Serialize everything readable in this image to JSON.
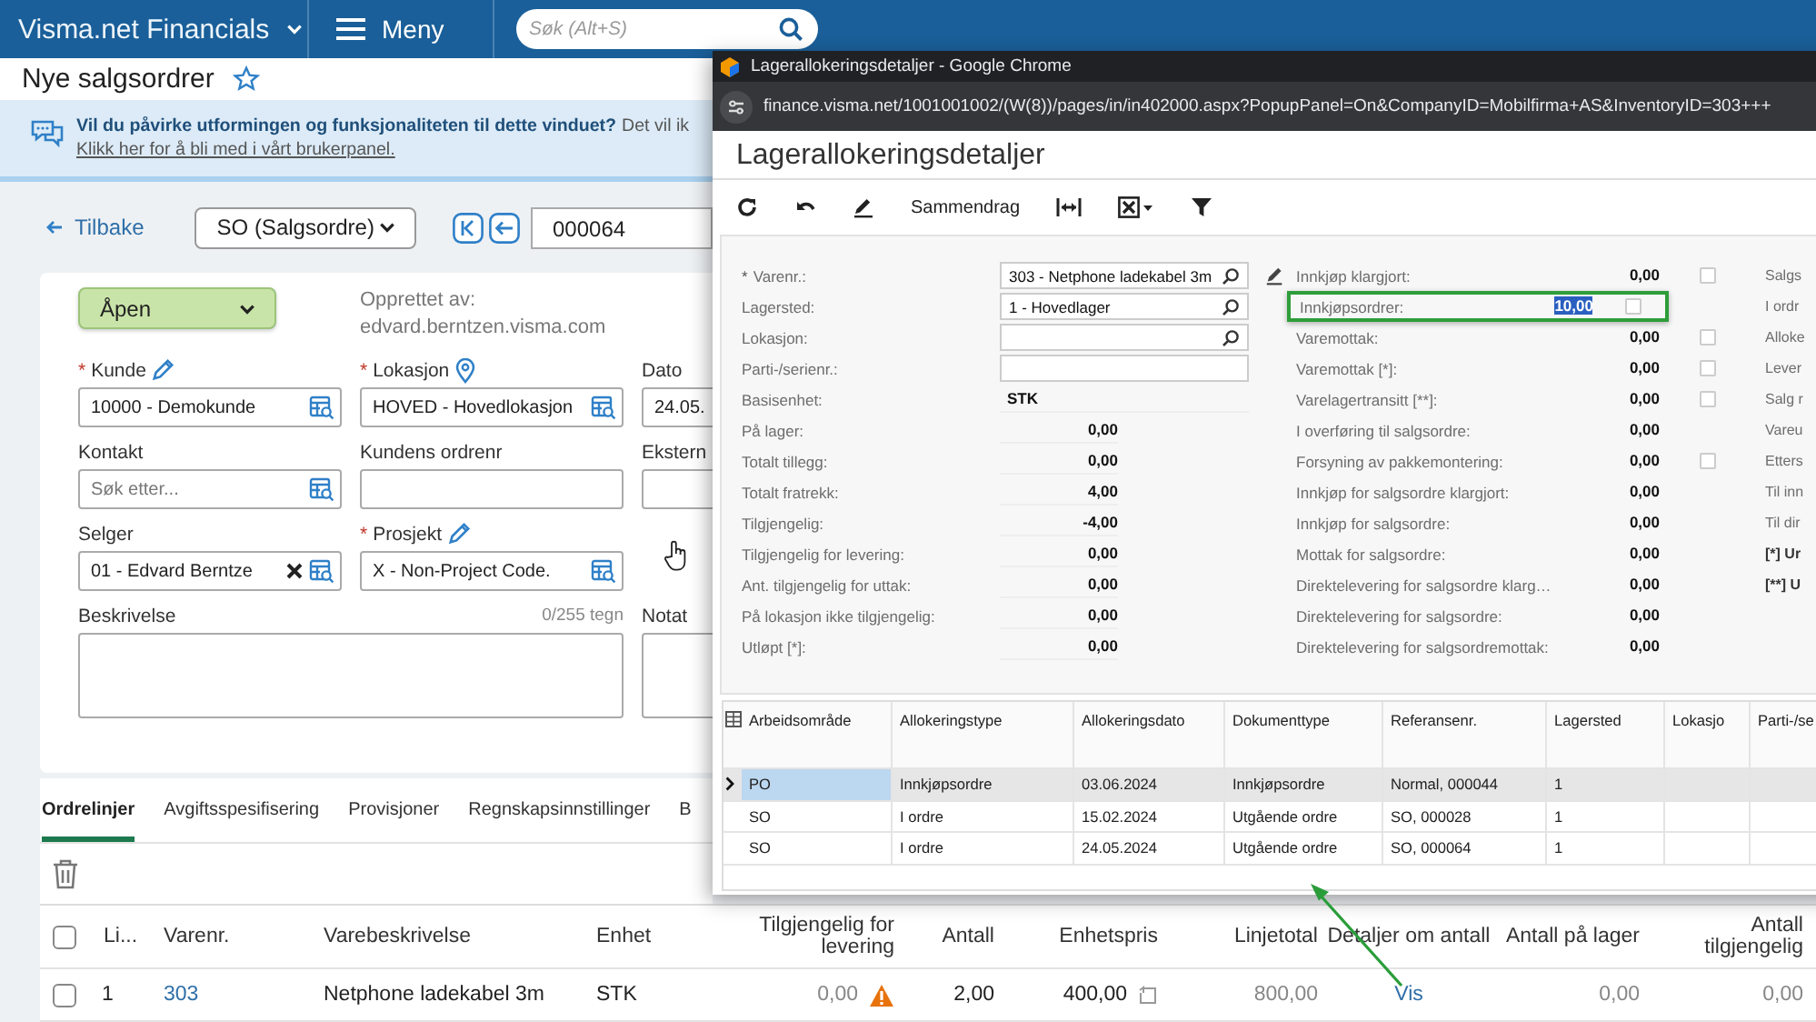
{
  "header": {
    "app_title": "Visma.net Financials",
    "menu_label": "Meny",
    "search": {
      "placeholder": "Søk (Alt+S)"
    }
  },
  "page": {
    "title": "Nye salgsordrer"
  },
  "banner": {
    "question": "Vil du påvirke utformingen og funksjonaliteten til dette vinduet?",
    "continuation": "Det vil ik",
    "link": "Klikk her for å bli med i vårt brukerpanel."
  },
  "nav": {
    "back": "Tilbake",
    "order_type": "SO (Salgsordre)",
    "order_number": "000064"
  },
  "form": {
    "status": "Åpen",
    "created_by_label": "Opprettet av:",
    "created_by": "edvard.berntzen.visma.com",
    "fields": [
      {
        "label": "Kunde",
        "required_mark": "*",
        "edit_link": true,
        "kind": "lookup",
        "value": "10000 - Demokunde"
      },
      {
        "label": "Lokasjon",
        "required_mark": "*",
        "location_link": true,
        "kind": "lookup",
        "value": "HOVED - Hovedlokasjon"
      },
      {
        "label": "Dato",
        "kind": "text",
        "value": "24.05."
      },
      {
        "label": "Kontakt",
        "kind": "lookup",
        "placeholder": "Søk etter..."
      },
      {
        "label": "Kundens ordrenr",
        "kind": "text"
      },
      {
        "label": "Ekstern",
        "kind": "text"
      },
      {
        "label": "Selger",
        "kind": "lookup",
        "value": "01 - Edvard Berntze",
        "clearable": true
      },
      {
        "label": "Prosjekt",
        "required_mark": "*",
        "edit_link": true,
        "kind": "lookup",
        "value": "X - Non-Project Code."
      },
      {
        "kind": "empty"
      },
      {
        "label": "Beskrivelse",
        "kind": "textarea",
        "counter": "0/255 tegn"
      },
      {
        "label": "Notat",
        "kind": "textarea"
      }
    ]
  },
  "tabs": [
    {
      "label": "Ordrelinjer",
      "selected": true
    },
    {
      "label": "Avgiftsspesifisering",
      "selected": false
    },
    {
      "label": "Provisjoner",
      "selected": false
    },
    {
      "label": "Regnskapsinnstillinger",
      "selected": false
    },
    {
      "label": "B",
      "selected": false
    }
  ],
  "order_lines": {
    "all_checked": false,
    "columns": [
      "Li...",
      "Varenr.",
      "Varebeskrivelse",
      "Enhet",
      "Tilgjengelig for levering",
      "Antall",
      "Enhetspris",
      "Linjetotal",
      "Detaljer om antall",
      "Antall på lager",
      "Antall tilgjengelig"
    ],
    "rows": [
      {
        "checked": false,
        "cells": [
          {
            "text": "1",
            "kind": "text"
          },
          {
            "text": "303",
            "kind": "link"
          },
          {
            "text": "Netphone ladekabel 3m",
            "kind": "text"
          },
          {
            "text": "STK",
            "kind": "text"
          },
          {
            "text": "0,00",
            "kind": "readonly",
            "warning": true
          },
          {
            "text": "2,00",
            "kind": "text"
          },
          {
            "text": "400,00",
            "kind": "text"
          },
          {
            "text": "800,00",
            "kind": "readonly"
          },
          {
            "text": "Vis",
            "kind": "link"
          },
          {
            "text": "0,00",
            "kind": "readonly"
          },
          {
            "text": "0,00",
            "kind": "readonly"
          }
        ]
      }
    ]
  },
  "popup": {
    "window_title": "Lagerallokeringsdetaljer - Google Chrome",
    "url": "finance.visma.net/1001001002/(W(8))/pages/in/in402000.aspx?PopupPanel=On&CompanyID=Mobilfirma+AS&InventoryID=303+++",
    "title": "Lagerallokeringsdetaljer",
    "summary_button": "Sammendrag",
    "form": {
      "column_1": [
        {
          "label": "Varenr.:",
          "required_mark": "*",
          "kind": "lookup",
          "value": "303 - Netphone ladekabel 3m",
          "editable": true
        },
        {
          "label": "Lagersted:",
          "kind": "lookup",
          "value": "1 - Hovedlager"
        },
        {
          "label": "Lokasjon:",
          "kind": "lookup"
        },
        {
          "label": "Parti-/serienr.:",
          "kind": "input"
        },
        {
          "label": "Basisenhet:",
          "kind": "plain",
          "value": "STK"
        },
        {
          "label": "På lager:",
          "kind": "number",
          "value": "0,00"
        },
        {
          "label": "Totalt tillegg:",
          "kind": "number",
          "value": "0,00"
        },
        {
          "label": "Totalt fratrekk:",
          "kind": "number",
          "value": "4,00"
        },
        {
          "label": "Tilgjengelig:",
          "kind": "number",
          "value": "-4,00"
        },
        {
          "label": "Tilgjengelig for levering:",
          "kind": "number",
          "value": "0,00"
        },
        {
          "label": "Ant. tilgjengelig for uttak:",
          "kind": "number",
          "value": "0,00"
        },
        {
          "label": "På lokasjon ikke tilgjengelig:",
          "kind": "number",
          "value": "0,00"
        },
        {
          "label": "Utløpt [*]:",
          "kind": "number",
          "value": "0,00"
        }
      ],
      "column_2": [
        {
          "label": "Innkjøp klargjort:",
          "value": "0,00",
          "checked": false
        },
        {
          "label": "Innkjøpsordrer:",
          "value": "10,00",
          "checked": false,
          "highlighted": true,
          "value_selected": true
        },
        {
          "label": "Varemottak:",
          "value": "0,00",
          "checked": false
        },
        {
          "label": "Varemottak [*]:",
          "value": "0,00",
          "checked": false
        },
        {
          "label": "Varelagertransitt [**]:",
          "value": "0,00",
          "checked": false
        },
        {
          "label": "I overføring til salgsordre:",
          "value": "0,00"
        },
        {
          "label": "Forsyning av pakkemontering:",
          "value": "0,00",
          "checked": false
        },
        {
          "label": "Innkjøp for salgsordre klargjort:",
          "value": "0,00"
        },
        {
          "label": "Innkjøp for salgsordre:",
          "value": "0,00"
        },
        {
          "label": "Mottak for salgsordre:",
          "value": "0,00"
        },
        {
          "label": "Direktelevering for salgsordre klarg…",
          "value": "0,00"
        },
        {
          "label": "Direktelevering for salgsordre:",
          "value": "0,00"
        },
        {
          "label": "Direktelevering for salgsordremottak:",
          "value": "0,00"
        }
      ],
      "column_3": [
        {
          "label": "Salgs",
          "kind": "label"
        },
        {
          "label": "I ordr",
          "kind": "label"
        },
        {
          "label": "Alloke",
          "kind": "label"
        },
        {
          "label": "Lever",
          "kind": "label"
        },
        {
          "label": "Salg r",
          "kind": "label"
        },
        {
          "label": "Vareu",
          "kind": "label"
        },
        {
          "label": "Etters",
          "kind": "label"
        },
        {
          "label": "Til inn",
          "kind": "label"
        },
        {
          "label": "Til dir",
          "kind": "label"
        },
        {
          "label": "[*] Ur",
          "kind": "note"
        },
        {
          "label": "[**] U",
          "kind": "note"
        }
      ]
    },
    "grid": {
      "columns": [
        "Arbeidsområde",
        "Allokeringstype",
        "Allokeringsdato",
        "Dokumenttype",
        "Referansenr.",
        "Lagersted",
        "Lokasjo",
        "Parti-/se"
      ],
      "rows": [
        {
          "selected": true,
          "cells": [
            "PO",
            "Innkjøpsordre",
            "03.06.2024",
            "Innkjøpsordre",
            "Normal, 000044",
            "1"
          ]
        },
        {
          "selected": false,
          "cells": [
            "SO",
            "I ordre",
            "15.02.2024",
            "Utgående ordre",
            "SO, 000028",
            "1"
          ]
        },
        {
          "selected": false,
          "cells": [
            "SO",
            "I ordre",
            "24.05.2024",
            "Utgående ordre",
            "SO, 000064",
            "1"
          ]
        }
      ]
    }
  }
}
